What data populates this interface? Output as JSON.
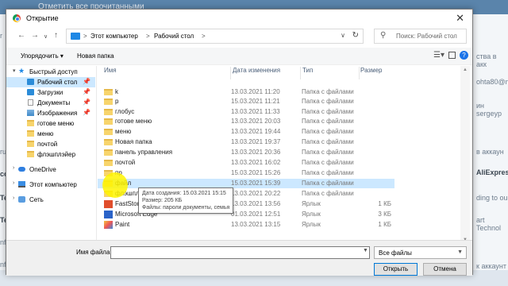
{
  "background": {
    "top_text": "Отметить все прочитанными",
    "right_texts": [
      "ства в акк",
      "ohta80@m",
      "ин sergeyp",
      "в аккаун",
      "AliExpress",
      "ding to ou",
      "art Technol",
      "к аккаунт"
    ],
    "left_texts": [
      "ru",
      "con",
      "Tech",
      "Tech",
      "nfa",
      "nfa",
      "r"
    ]
  },
  "dialog": {
    "title": "Открытие",
    "close_icon": "✕",
    "address": {
      "crumbs": [
        "Этот компьютер",
        "Рабочий стол"
      ],
      "separator": ">"
    },
    "search_placeholder": "Поиск: Рабочий стол",
    "toolbar": {
      "organize": "Упорядочить ▾",
      "new_folder": "Новая папка"
    },
    "nav": [
      {
        "label": "Быстрый доступ",
        "icon": "star-icon",
        "level": 0,
        "expanded": true
      },
      {
        "label": "Рабочий стол",
        "icon": "folder-icon",
        "level": 1,
        "pinned": true,
        "selected": true
      },
      {
        "label": "Загрузки",
        "icon": "download-folder-icon",
        "level": 1,
        "pinned": true
      },
      {
        "label": "Документы",
        "icon": "documents-icon",
        "level": 1,
        "pinned": true
      },
      {
        "label": "Изображения",
        "icon": "pictures-icon",
        "level": 1,
        "pinned": true
      },
      {
        "label": "готове меню",
        "icon": "folder-icon",
        "level": 1
      },
      {
        "label": "меню",
        "icon": "folder-icon",
        "level": 1
      },
      {
        "label": "почтой",
        "icon": "folder-icon",
        "level": 1
      },
      {
        "label": "флэшплэйер",
        "icon": "folder-icon",
        "level": 1
      },
      {
        "label": "OneDrive",
        "icon": "onedrive-icon",
        "level": 0
      },
      {
        "label": "Этот компьютер",
        "icon": "computer-icon",
        "level": 0
      },
      {
        "label": "Сеть",
        "icon": "network-icon",
        "level": 0
      }
    ],
    "columns": {
      "name": "Имя",
      "date": "Дата изменения",
      "type": "Тип",
      "size": "Размер"
    },
    "files": [
      {
        "name": "k",
        "date": "13.03.2021 11:20",
        "type": "Папка с файлами",
        "size": "",
        "icon": "folder-icon"
      },
      {
        "name": "p",
        "date": "15.03.2021 11:21",
        "type": "Папка с файлами",
        "size": "",
        "icon": "folder-icon"
      },
      {
        "name": "глобус",
        "date": "13.03.2021 11:33",
        "type": "Папка с файлами",
        "size": "",
        "icon": "folder-icon"
      },
      {
        "name": "готове меню",
        "date": "13.03.2021 20:03",
        "type": "Папка с файлами",
        "size": "",
        "icon": "folder-icon"
      },
      {
        "name": "меню",
        "date": "13.03.2021 19:44",
        "type": "Папка с файлами",
        "size": "",
        "icon": "folder-icon"
      },
      {
        "name": "Новая папка",
        "date": "13.03.2021 19:37",
        "type": "Папка с файлами",
        "size": "",
        "icon": "folder-icon"
      },
      {
        "name": "панель управления",
        "date": "13.03.2021 20:36",
        "type": "Папка с файлами",
        "size": "",
        "icon": "folder-icon"
      },
      {
        "name": "почтой",
        "date": "13.03.2021 16:02",
        "type": "Папка с файлами",
        "size": "",
        "icon": "folder-icon"
      },
      {
        "name": "пр",
        "date": "15.03.2021 15:26",
        "type": "Папка с файлами",
        "size": "",
        "icon": "folder-icon"
      },
      {
        "name": "файл",
        "date": "15.03.2021 15:39",
        "type": "Папка с файлами",
        "size": "",
        "icon": "folder-icon",
        "hover": true
      },
      {
        "name": "флэшпл",
        "date": "13.03.2021 20:22",
        "type": "Папка с файлами",
        "size": "",
        "icon": "folder-icon"
      },
      {
        "name": "FastStone",
        "date": "13.03.2021 13:56",
        "type": "Ярлык",
        "size": "1 КБ",
        "icon": "app-icon-faststone"
      },
      {
        "name": "Microsoft Edge",
        "date": "01.03.2021 12:51",
        "type": "Ярлык",
        "size": "3 КБ",
        "icon": "app-icon-edge"
      },
      {
        "name": "Paint",
        "date": "13.03.2021 13:15",
        "type": "Ярлык",
        "size": "1 КБ",
        "icon": "app-icon-paint"
      }
    ],
    "tooltip": [
      "Дата создания: 15.03.2021 15:15",
      "Размер: 205 КБ",
      "Файлы: пароли документы, семья"
    ],
    "filename_label": "Имя файла:",
    "filename_value": "",
    "filetype_value": "Все файлы",
    "open_button": "Открыть",
    "cancel_button": "Отмена"
  }
}
